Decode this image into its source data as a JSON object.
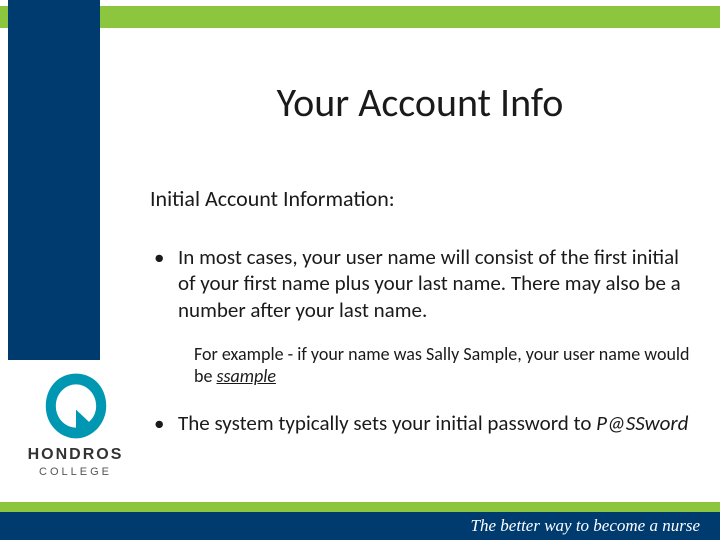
{
  "colors": {
    "green": "#8CC63F",
    "blue": "#003B6F"
  },
  "title": "Your Account Info",
  "subheading": "Initial Account Information:",
  "bullets": [
    {
      "text": "In most cases, your user name will consist of the first initial of your first name plus your last name. There may also be a number after your last name."
    },
    {
      "prefix": "The system typically sets your initial password to ",
      "italic": "P@SSword"
    }
  ],
  "example": {
    "prefix": "For example - if your name was Sally Sample, your user name would be ",
    "emph": "ssample"
  },
  "logo": {
    "name": "HONDROS",
    "sub": "COLLEGE"
  },
  "tagline": "The better way to become a nurse"
}
